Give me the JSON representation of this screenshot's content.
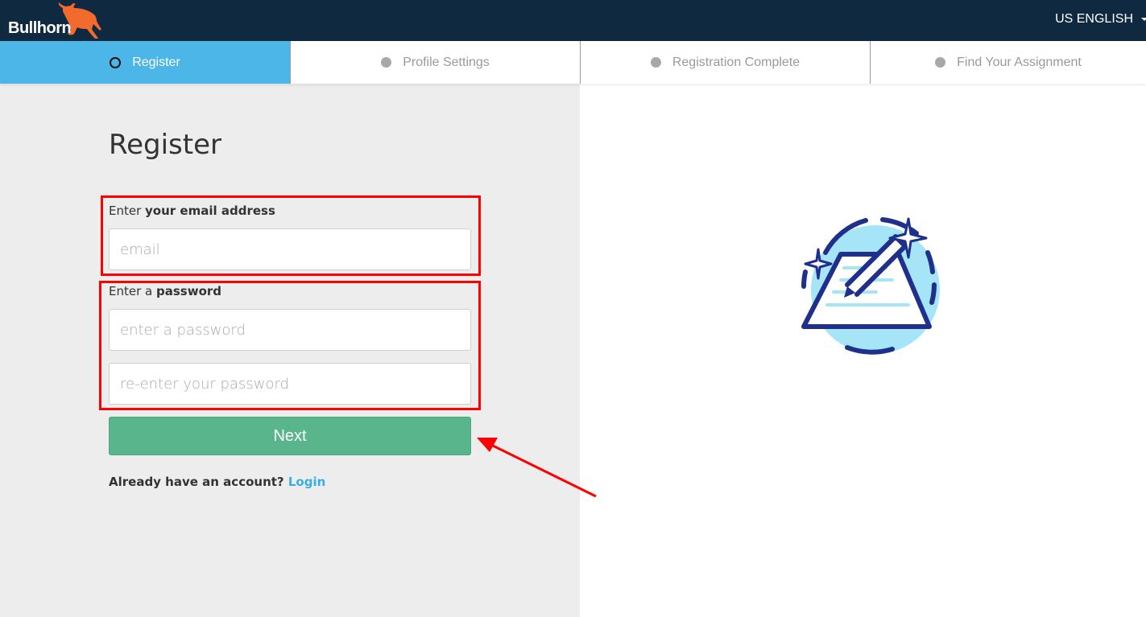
{
  "header": {
    "brand": "Bullhorn",
    "language_label": "US ENGLISH",
    "colors": {
      "bar": "#0f2a40",
      "bull": "#f26b2d"
    }
  },
  "steps": [
    {
      "label": "Register",
      "state": "active"
    },
    {
      "label": "Profile Settings",
      "state": "pending"
    },
    {
      "label": "Registration Complete",
      "state": "pending"
    },
    {
      "label": "Find Your Assignment",
      "state": "pending"
    }
  ],
  "form": {
    "title": "Register",
    "email_label_prefix": "Enter ",
    "email_label_bold": "your email address",
    "email_value": "",
    "email_placeholder": "email",
    "password_label_prefix": "Enter a ",
    "password_label_bold": "password",
    "password_value": "",
    "password_placeholder": "enter a password",
    "confirm_value": "",
    "confirm_placeholder": "re-enter your password",
    "next_label": "Next",
    "account_prompt": "Already have an account?",
    "login_label": "Login"
  },
  "colors": {
    "active_step": "#4db6e8",
    "next_button": "#59b68c",
    "login_link": "#3aaee3",
    "annotation": "#ff0000"
  },
  "illustration": {
    "icon": "edit-document-icon"
  }
}
